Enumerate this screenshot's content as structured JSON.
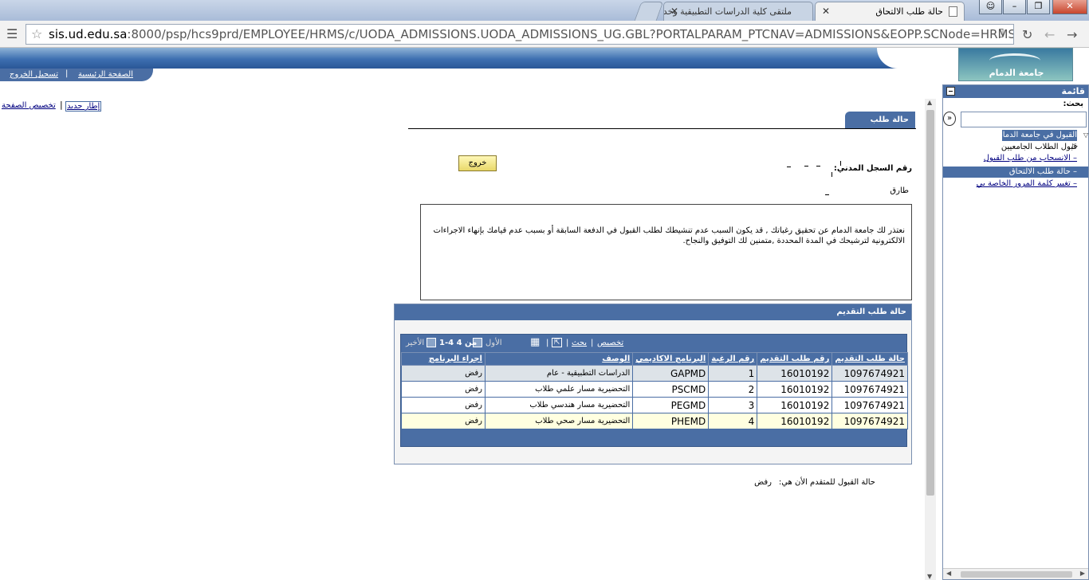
{
  "browser": {
    "tabs": [
      {
        "title": "حالة طلب الالتحاق",
        "active": true
      },
      {
        "title": "ملتقى كلية الدراسات التطبيقية وخدمة",
        "active": false
      }
    ],
    "address": {
      "host": "sis.ud.edu.sa",
      "rest": ":8000/psp/hcs9prd/EMPLOYEE/HRMS/c/UODA_ADMISSIONS.UODA_ADMISSIONS_UG.GBL?PORTALPARAM_PTCNAV=ADMISSIONS&EOPP.SCNode=HRMS&"
    },
    "window_buttons": {
      "minimize": "–",
      "maximize": "❐",
      "close": "✕"
    }
  },
  "header": {
    "home_link": "الصفحة الرئيسية",
    "logout_link": "تسجيل الخروج",
    "logo_text": "جامعة الدمام",
    "new_window_link": "إطار جديد",
    "customize_page_link": "تخصيص الصفحة"
  },
  "menu": {
    "title": "قائمة",
    "search_label": "بحث:",
    "search_placeholder": "",
    "items": [
      {
        "label": "القبول في جامعة الدمام",
        "selected": true,
        "link": false
      },
      {
        "label": "قبول الطلاب الجامعيين",
        "selected": false,
        "link": false
      },
      {
        "label": "– الانسحاب من طلب القبول",
        "selected": false,
        "link": true
      },
      {
        "label": "– حالة طلب الالتحاق",
        "selected": true,
        "link": false
      },
      {
        "label": "– تغيير كلمة المرور الخاصة بي",
        "selected": false,
        "link": true
      }
    ]
  },
  "main": {
    "page_tab": "حالة طلب التقديم",
    "exit_button": "خروج",
    "civil_id_label": "رقم السجل المدني:",
    "name_value": "طارق",
    "message": "نعتذر لك جامعة الدمام عن تحقيق رغباتك , قد يكون السبب عدم تنشيطك لطلب القبول في الدفعة السابقة أو بسبب عدم قيامك بإنهاء الاجراءات الالكترونية لترشيحك في المدة المحددة ,متمنين لك التوفيق والنجاح.",
    "final_status_label": "حالة القبول للمتقدم الأن هي:",
    "final_status_value": "رفض"
  },
  "grid": {
    "title": "حالة طلب التقديم",
    "nav": {
      "customize": "تخصيص",
      "find": "بحث",
      "first": "الأول",
      "range": "1-4 من 4",
      "last": "الأخير"
    },
    "columns": [
      "حالة طلب التقديم",
      "رقم طلب التقديم",
      "رقم الرغبة",
      "البرنامج الاكاديمي",
      "الوصف",
      "اجراء البرنامج"
    ],
    "rows": [
      {
        "app_status": "1097674921",
        "app_number": "16010192",
        "choice": "1",
        "program": "GAPMD",
        "description": "الدراسات التطبيقية - عام",
        "action": "رفض"
      },
      {
        "app_status": "1097674921",
        "app_number": "16010192",
        "choice": "2",
        "program": "PSCMD",
        "description": "التحضيرية مسار علمي طلاب",
        "action": "رفض"
      },
      {
        "app_status": "1097674921",
        "app_number": "16010192",
        "choice": "3",
        "program": "PEGMD",
        "description": "التحضيرية مسار هندسي طلاب",
        "action": "رفض"
      },
      {
        "app_status": "1097674921",
        "app_number": "16010192",
        "choice": "4",
        "program": "PHEMD",
        "description": "التحضيرية مسار صحي طلاب",
        "action": "رفض"
      }
    ]
  },
  "colors": {
    "accent": "#4a6ea4",
    "link": "#000080",
    "highlight_row": "#ffffe0"
  }
}
